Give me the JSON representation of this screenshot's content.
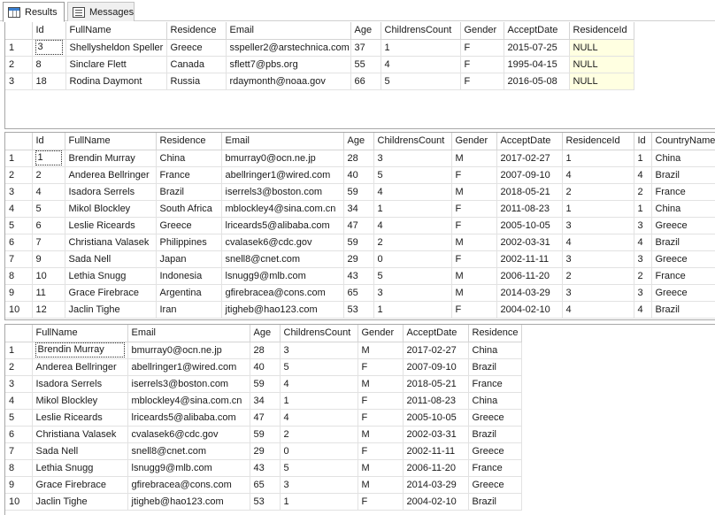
{
  "tabs": [
    {
      "label": "Results",
      "icon": "results-grid-icon"
    },
    {
      "label": "Messages",
      "icon": "messages-icon"
    }
  ],
  "result1": {
    "columns": [
      "",
      "Id",
      "FullName",
      "Residence",
      "Email",
      "Age",
      "ChildrensCount",
      "Gender",
      "AcceptDate",
      "ResidenceId"
    ],
    "rows": [
      [
        "1",
        "3",
        "Shellysheldon Speller",
        "Greece",
        "sspeller2@arstechnica.com",
        "37",
        "1",
        "F",
        "2015-07-25",
        "NULL"
      ],
      [
        "2",
        "8",
        "Sinclare Flett",
        "Canada",
        "sflett7@pbs.org",
        "55",
        "4",
        "F",
        "1995-04-15",
        "NULL"
      ],
      [
        "3",
        "18",
        "Rodina Daymont",
        "Russia",
        "rdaymonth@noaa.gov",
        "66",
        "5",
        "F",
        "2016-05-08",
        "NULL"
      ]
    ]
  },
  "result2": {
    "columns": [
      "",
      "Id",
      "FullName",
      "Residence",
      "Email",
      "Age",
      "ChildrensCount",
      "Gender",
      "AcceptDate",
      "ResidenceId",
      "Id",
      "CountryName"
    ],
    "rows": [
      [
        "1",
        "1",
        "Brendin Murray",
        "China",
        "bmurray0@ocn.ne.jp",
        "28",
        "3",
        "M",
        "2017-02-27",
        "1",
        "1",
        "China"
      ],
      [
        "2",
        "2",
        "Anderea Bellringer",
        "France",
        "abellringer1@wired.com",
        "40",
        "5",
        "F",
        "2007-09-10",
        "4",
        "4",
        "Brazil"
      ],
      [
        "3",
        "4",
        "Isadora Serrels",
        "Brazil",
        "iserrels3@boston.com",
        "59",
        "4",
        "M",
        "2018-05-21",
        "2",
        "2",
        "France"
      ],
      [
        "4",
        "5",
        "Mikol Blockley",
        "South Africa",
        "mblockley4@sina.com.cn",
        "34",
        "1",
        "F",
        "2011-08-23",
        "1",
        "1",
        "China"
      ],
      [
        "5",
        "6",
        "Leslie Riceards",
        "Greece",
        "lriceards5@alibaba.com",
        "47",
        "4",
        "F",
        "2005-10-05",
        "3",
        "3",
        "Greece"
      ],
      [
        "6",
        "7",
        "Christiana Valasek",
        "Philippines",
        "cvalasek6@cdc.gov",
        "59",
        "2",
        "M",
        "2002-03-31",
        "4",
        "4",
        "Brazil"
      ],
      [
        "7",
        "9",
        "Sada Nell",
        "Japan",
        "snell8@cnet.com",
        "29",
        "0",
        "F",
        "2002-11-11",
        "3",
        "3",
        "Greece"
      ],
      [
        "8",
        "10",
        "Lethia Snugg",
        "Indonesia",
        "lsnugg9@mlb.com",
        "43",
        "5",
        "M",
        "2006-11-20",
        "2",
        "2",
        "France"
      ],
      [
        "9",
        "11",
        "Grace Firebrace",
        "Argentina",
        "gfirebracea@cons.com",
        "65",
        "3",
        "M",
        "2014-03-29",
        "3",
        "3",
        "Greece"
      ],
      [
        "10",
        "12",
        "Jaclin Tighe",
        "Iran",
        "jtigheb@hao123.com",
        "53",
        "1",
        "F",
        "2004-02-10",
        "4",
        "4",
        "Brazil"
      ]
    ]
  },
  "result3": {
    "columns": [
      "",
      "FullName",
      "Email",
      "Age",
      "ChildrensCount",
      "Gender",
      "AcceptDate",
      "Residence"
    ],
    "rows": [
      [
        "1",
        "Brendin Murray",
        "bmurray0@ocn.ne.jp",
        "28",
        "3",
        "M",
        "2017-02-27",
        "China"
      ],
      [
        "2",
        "Anderea Bellringer",
        "abellringer1@wired.com",
        "40",
        "5",
        "F",
        "2007-09-10",
        "Brazil"
      ],
      [
        "3",
        "Isadora Serrels",
        "iserrels3@boston.com",
        "59",
        "4",
        "M",
        "2018-05-21",
        "France"
      ],
      [
        "4",
        "Mikol Blockley",
        "mblockley4@sina.com.cn",
        "34",
        "1",
        "F",
        "2011-08-23",
        "China"
      ],
      [
        "5",
        "Leslie Riceards",
        "lriceards5@alibaba.com",
        "47",
        "4",
        "F",
        "2005-10-05",
        "Greece"
      ],
      [
        "6",
        "Christiana Valasek",
        "cvalasek6@cdc.gov",
        "59",
        "2",
        "M",
        "2002-03-31",
        "Brazil"
      ],
      [
        "7",
        "Sada Nell",
        "snell8@cnet.com",
        "29",
        "0",
        "F",
        "2002-11-11",
        "Greece"
      ],
      [
        "8",
        "Lethia Snugg",
        "lsnugg9@mlb.com",
        "43",
        "5",
        "M",
        "2006-11-20",
        "France"
      ],
      [
        "9",
        "Grace Firebrace",
        "gfirebracea@cons.com",
        "65",
        "3",
        "M",
        "2014-03-29",
        "Greece"
      ],
      [
        "10",
        "Jaclin Tighe",
        "jtigheb@hao123.com",
        "53",
        "1",
        "F",
        "2004-02-10",
        "Brazil"
      ]
    ]
  },
  "colors": {
    "null_cell_bg": "#ffffe1",
    "grid_line": "#e2e2e2",
    "pane_border": "#a8a8a8"
  }
}
